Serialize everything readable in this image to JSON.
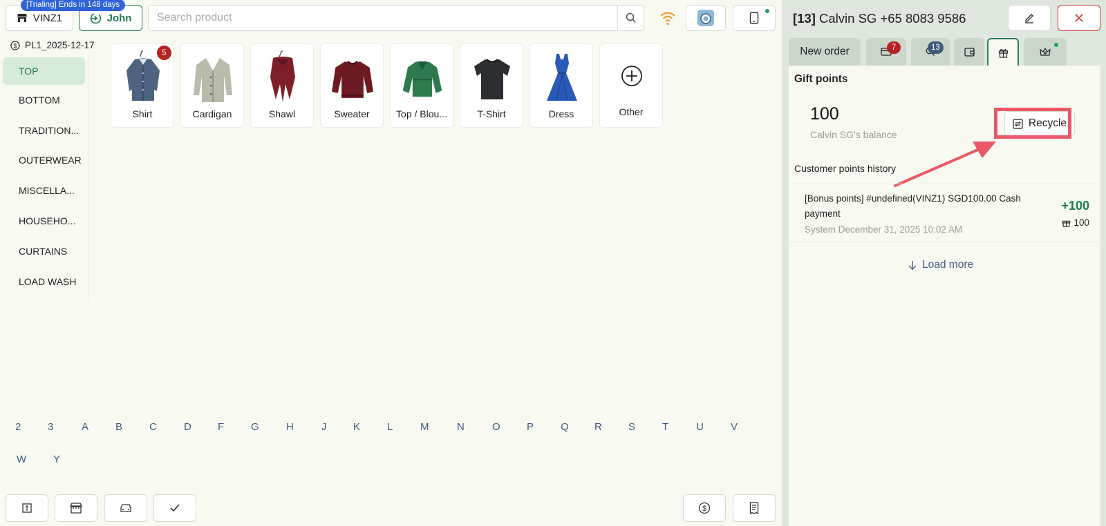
{
  "header": {
    "store_label": "VINZ1",
    "trial_badge": "[Trialing] Ends in 148 days",
    "user_label": "John",
    "search_placeholder": "Search product"
  },
  "pricelist": "PL1_2025-12-17",
  "categories": [
    "TOP",
    "BOTTOM",
    "TRADITION...",
    "OUTERWEAR",
    "MISCELLA...",
    "HOUSEHO...",
    "CURTAINS",
    "LOAD WASH"
  ],
  "items": [
    {
      "label": "Shirt",
      "badge": "5",
      "icon": "shirt-icon"
    },
    {
      "label": "Cardigan",
      "badge": "",
      "icon": "cardigan-icon"
    },
    {
      "label": "Shawl",
      "badge": "",
      "icon": "shawl-icon"
    },
    {
      "label": "Sweater",
      "badge": "",
      "icon": "sweater-icon"
    },
    {
      "label": "Top / Blou...",
      "badge": "",
      "icon": "blouse-icon"
    },
    {
      "label": "T-Shirt",
      "badge": "",
      "icon": "tshirt-icon"
    },
    {
      "label": "Dress",
      "badge": "",
      "icon": "dress-icon"
    },
    {
      "label": "Other",
      "badge": "",
      "icon": "plus-circle-icon"
    }
  ],
  "alphabet_row1": [
    "2",
    "3",
    "A",
    "B",
    "C",
    "D",
    "F",
    "G",
    "H",
    "J",
    "K",
    "L",
    "M",
    "N",
    "O",
    "P",
    "Q",
    "R",
    "S",
    "T",
    "U",
    "V"
  ],
  "alphabet_row2": [
    "W",
    "Y"
  ],
  "panel": {
    "order_number": "[13]",
    "customer": "Calvin SG +65 8083 9586",
    "tabs": {
      "new_order": "New order",
      "payments_badge": "7",
      "search_badge": "13"
    },
    "gift": {
      "title": "Gift points",
      "balance": "100",
      "balance_label": "Calvin SG's balance",
      "recycle_label": "Recycle",
      "history_label": "Customer points history",
      "history": [
        {
          "description": "[Bonus points] #undefined(VINZ1) SGD100.00 Cash payment",
          "meta": "System December 31, 2025 10:02 AM",
          "delta": "+100",
          "total": "100"
        }
      ],
      "load_more": "Load more"
    }
  },
  "colors": {
    "accent_green": "#1e7a4f",
    "badge_red": "#b62121",
    "highlight_red": "#e95866",
    "trial_blue": "#2f63d9"
  }
}
